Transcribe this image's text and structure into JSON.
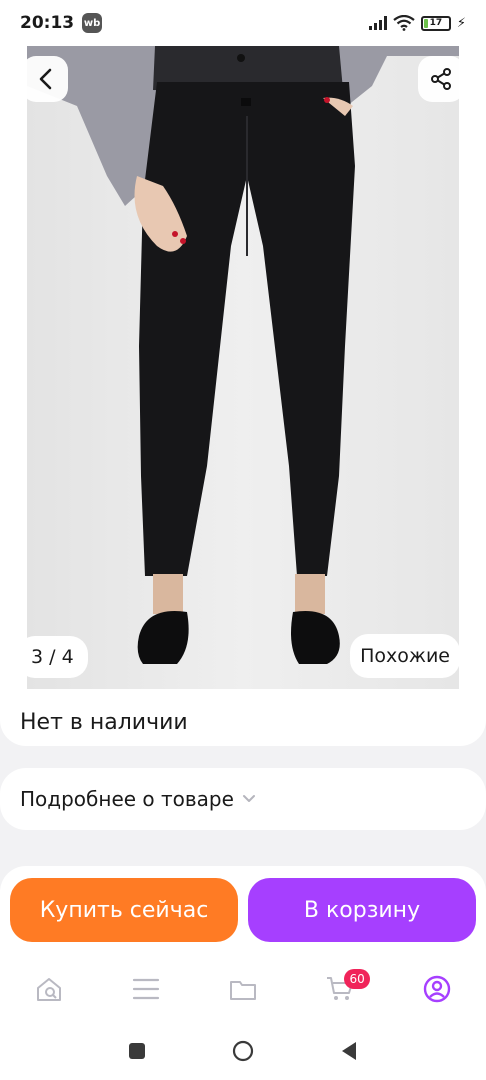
{
  "status_bar": {
    "time": "20:13",
    "app_badge": "wb",
    "battery_level": "17",
    "battery_fraction": 0.17
  },
  "gallery": {
    "counter": "3 / 4",
    "similar_label": "Похожие"
  },
  "product": {
    "stock_status": "Нет в наличии"
  },
  "details": {
    "label": "Подробнее о товаре"
  },
  "actions": {
    "buy_now": "Купить сейчас",
    "add_to_cart": "В корзину"
  },
  "tab_bar": {
    "cart_count": "60"
  },
  "colors": {
    "buy_button": "#ff7b24",
    "cart_button": "#a63fff",
    "accent": "#a63fff",
    "badge": "#f0245a"
  }
}
